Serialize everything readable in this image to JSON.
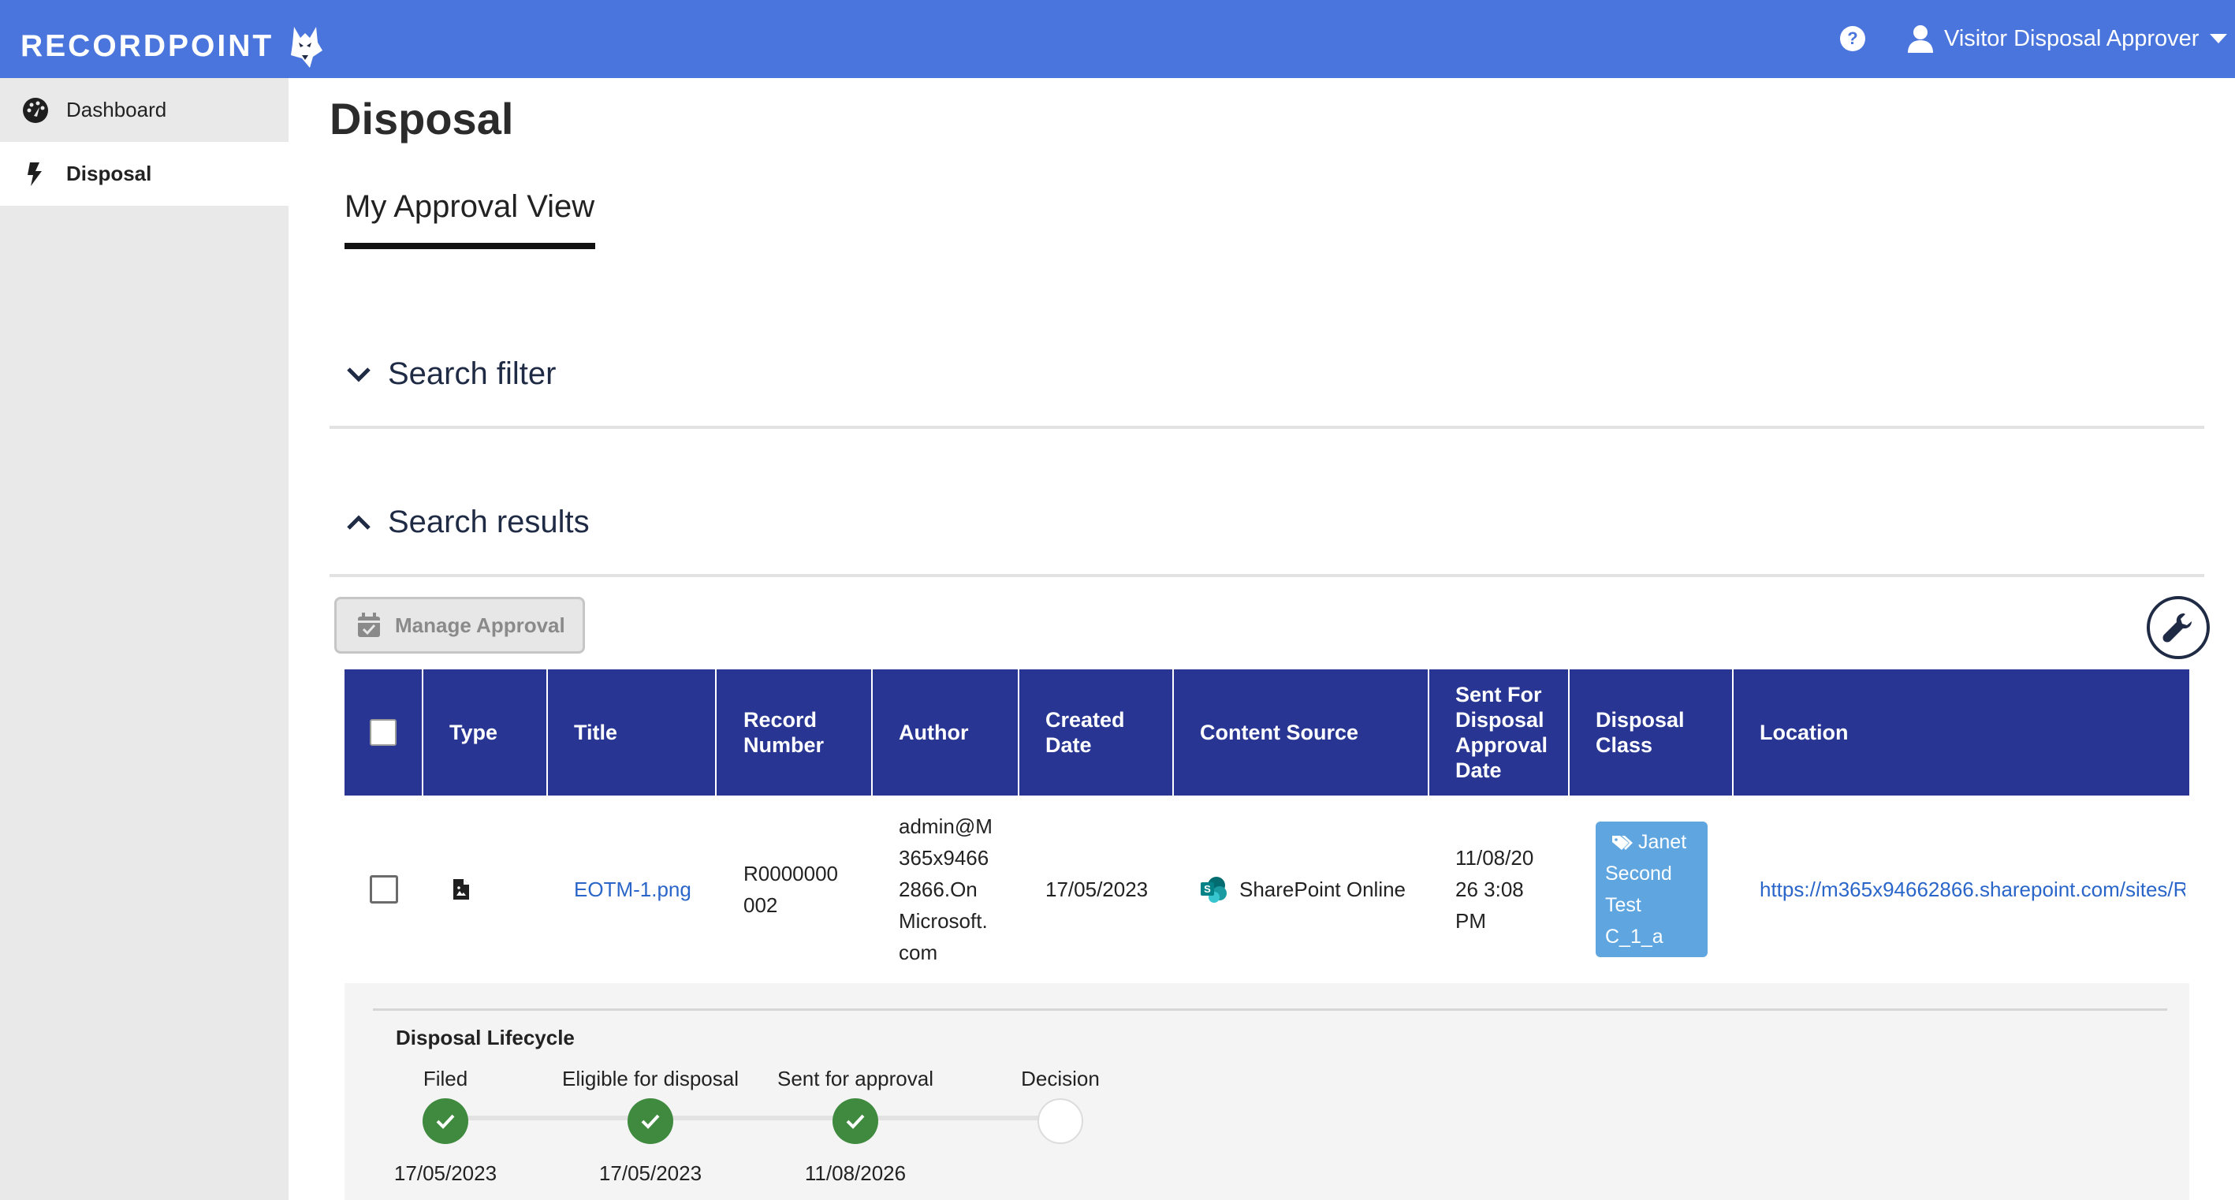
{
  "app": {
    "brand": "RECORDPOINT",
    "user_name": "Visitor Disposal Approver",
    "help_label": "?"
  },
  "sidebar": {
    "items": [
      {
        "label": "Dashboard",
        "icon": "dashboard-icon"
      },
      {
        "label": "Disposal",
        "icon": "lightning-icon",
        "active": true
      }
    ]
  },
  "main": {
    "title": "Disposal",
    "tab": "My Approval View",
    "search_filter": "Search filter",
    "search_results": "Search results",
    "manage_approval": "Manage Approval"
  },
  "table": {
    "headers": {
      "type": "Type",
      "title": "Title",
      "record_number_1": "Record",
      "record_number_2": "Number",
      "author": "Author",
      "created_1": "Created",
      "created_2": "Date",
      "content_source": "Content Source",
      "sent_1": "Sent For",
      "sent_2": "Disposal",
      "sent_3": "Approval",
      "sent_4": "Date",
      "class_1": "Disposal",
      "class_2": "Class",
      "location": "Location"
    },
    "row": {
      "title": "EOTM-1.png",
      "record_1": "R0000000",
      "record_2": "002",
      "author_1": "admin@M",
      "author_2": "365x9466",
      "author_3": "2866.On",
      "author_4": "Microsoft.",
      "author_5": "com",
      "created": "17/05/2023",
      "content_source": "SharePoint Online",
      "sent_1": "11/08/20",
      "sent_2": "26 3:08",
      "sent_3": "PM",
      "class_1": "Janet",
      "class_2": "Second",
      "class_3": "Test",
      "class_4": "C_1_a",
      "location": "https://m365x94662866.sharepoint.com/sites/R"
    }
  },
  "lifecycle": {
    "title": "Disposal Lifecycle",
    "steps": [
      {
        "label": "Filed",
        "date": "17/05/2023",
        "done": true
      },
      {
        "label": "Eligible for disposal",
        "date": "17/05/2023",
        "done": true
      },
      {
        "label": "Sent for approval",
        "date": "11/08/2026",
        "done": true
      },
      {
        "label": "Decision",
        "date": "",
        "done": false
      }
    ]
  },
  "colors": {
    "topbar": "#4a75dc",
    "table_header": "#283593",
    "link": "#2a66c9",
    "step_done": "#3f8a3f",
    "class_chip": "#5fa6e0"
  }
}
